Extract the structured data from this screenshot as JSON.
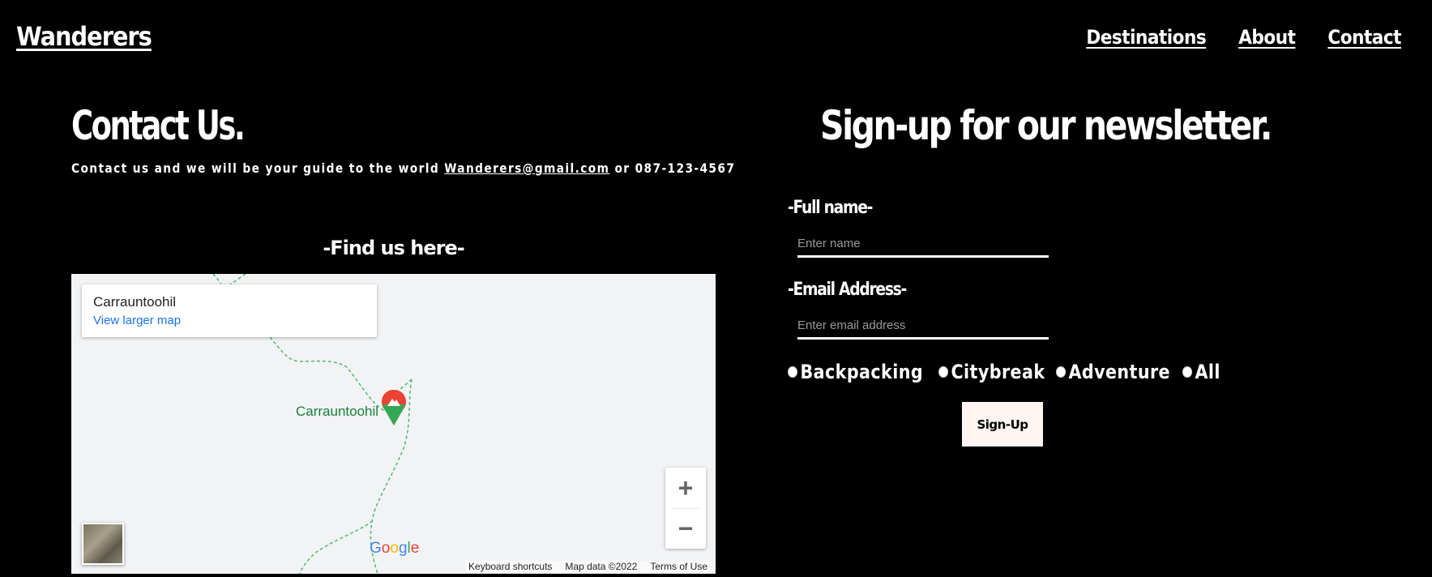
{
  "header": {
    "brand": "Wanderers",
    "nav": [
      "Destinations",
      "About",
      "Contact"
    ]
  },
  "contact": {
    "title": "Contact Us.",
    "text_before": "Contact us and we will be your guide to the world ",
    "email": "Wanderers@gmail.com",
    "text_after": " or 087-123-4567",
    "find_title": "-Find us here-"
  },
  "map": {
    "place_name": "Carrauntoohil",
    "larger_map": "View larger map",
    "pin_label": "Carrauntoohil",
    "zoom_in": "+",
    "zoom_out": "−",
    "logo": "Google",
    "attribution": {
      "shortcuts": "Keyboard shortcuts",
      "data": "Map data ©2022",
      "terms": "Terms of Use"
    },
    "pin_color_top": "#ea4335",
    "pin_color_bottom": "#34a853",
    "trail_color": "#4cbb6a"
  },
  "newsletter": {
    "title": "Sign-up for our newsletter.",
    "full_name_label": "-Full name-",
    "full_name_placeholder": "Enter name",
    "email_label": "-Email Address-",
    "email_placeholder": "Enter email address",
    "options": [
      "Backpacking",
      "Citybreak",
      "Adventure",
      "All"
    ],
    "button": "Sign-Up"
  }
}
